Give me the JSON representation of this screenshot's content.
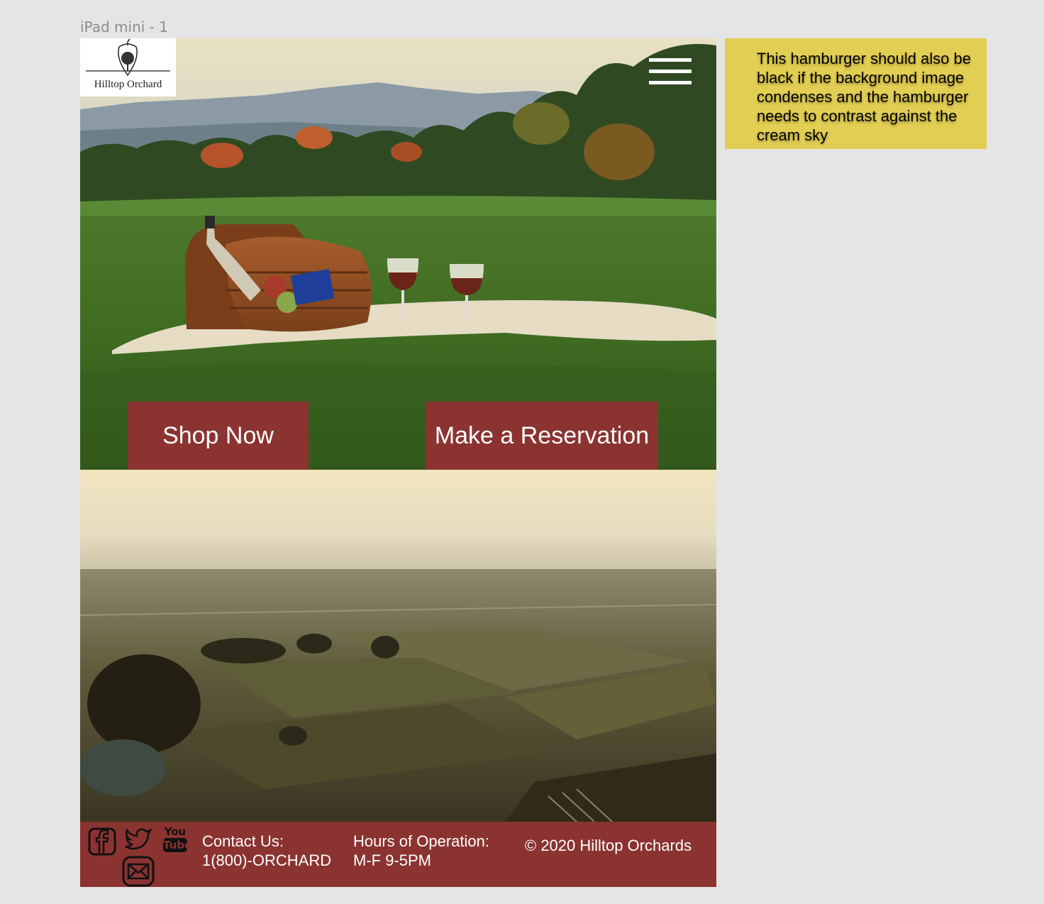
{
  "frame": {
    "label": "iPad mini - 1"
  },
  "header": {
    "logo_text": "Hilltop Orchard",
    "menu_icon": "hamburger-menu-icon"
  },
  "hero": {
    "shop_button": "Shop Now",
    "reserve_button": "Make a Reservation"
  },
  "footer": {
    "social_icons": [
      "facebook-icon",
      "twitter-icon",
      "youtube-icon",
      "email-icon"
    ],
    "youtube_text_top": "You",
    "youtube_text_bottom": "Tube",
    "contact_label": "Contact Us:",
    "contact_value": "1(800)-ORCHARD",
    "hours_label": "Hours of Operation:",
    "hours_value": "M-F 9-5PM",
    "copyright": "© 2020 Hilltop Orchards"
  },
  "note": {
    "text": "This hamburger should also be black if the background image condenses and the hamburger needs to contrast against the cream sky"
  },
  "colors": {
    "brand_red": "#8b3331",
    "note_yellow": "#e2ce52",
    "canvas_gray": "#e5e5e5"
  }
}
